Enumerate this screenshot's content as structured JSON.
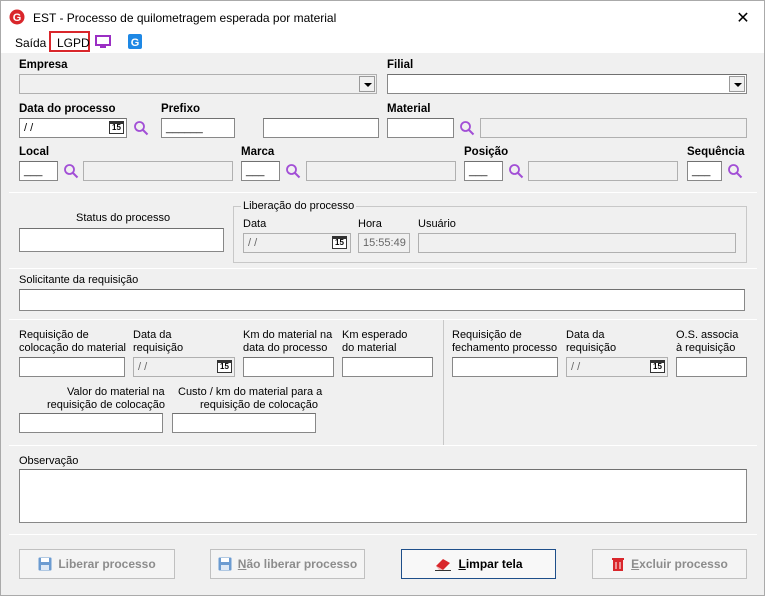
{
  "window": {
    "title": "EST - Processo de quilometragem esperada por material",
    "close_glyph": "✕"
  },
  "menu": {
    "saida": "Saída",
    "lgpd": "LGPD",
    "icons": [
      "monitor-icon",
      "g-app-icon"
    ]
  },
  "colors": {
    "accent_red": "#d9262b",
    "lgpd_border": "#d9262b",
    "monitor_purple": "#9b2fc4",
    "app_blue": "#1e88e5",
    "search_purple": "#a24fd6"
  },
  "header": {
    "empresa_label": "Empresa",
    "empresa_value": "",
    "filial_label": "Filial",
    "filial_value": "",
    "data_processo_label": "Data do processo",
    "data_processo_value": " / /",
    "prefixo_label": "Prefixo",
    "prefixo_value": "______",
    "prefixo_desc": "",
    "material_label": "Material",
    "material_value": "",
    "material_desc": "",
    "local_label": "Local",
    "local_value": "___",
    "local_desc": "",
    "marca_label": "Marca",
    "marca_value": "___",
    "marca_desc": "",
    "posicao_label": "Posição",
    "posicao_value": "___",
    "posicao_desc": "",
    "sequencia_label": "Sequência",
    "sequencia_value": "___",
    "cal_label": "15"
  },
  "status": {
    "label": "Status do processo",
    "value": ""
  },
  "liberacao": {
    "group_label": "Liberação do processo",
    "data_label": "Data",
    "data_value": " / /",
    "hora_label": "Hora",
    "hora_value": "15:55:49",
    "usuario_label": "Usuário",
    "usuario_value": ""
  },
  "solicitante": {
    "label": "Solicitante da requisição",
    "value": ""
  },
  "colocacao": {
    "req_label_1": "Requisição de",
    "req_label_2": "colocação do material",
    "data_label_1": "Data da",
    "data_label_2": "requisição",
    "data_value": " / /",
    "km_mat_label_1": "Km do material na",
    "km_mat_label_2": "data do processo",
    "km_esp_label_1": "Km esperado",
    "km_esp_label_2": "do material",
    "valor_label_1": "Valor do material na",
    "valor_label_2": "requisição de colocação",
    "custo_label_1": "Custo / km do material para a",
    "custo_label_2": "requisição de colocação"
  },
  "fechamento": {
    "req_label_1": "Requisição de",
    "req_label_2": "fechamento processo",
    "data_label_1": "Data da",
    "data_label_2": "requisição",
    "data_value": " / /",
    "os_label_1": "O.S. associa",
    "os_label_2": "à requisição"
  },
  "observacao": {
    "label": "Observação",
    "value": ""
  },
  "buttons": {
    "liberar": "Liberar processo",
    "nao_liberar_first": "N",
    "nao_liberar_rest": "ão liberar processo",
    "limpar_first": "L",
    "limpar_rest": "impar tela",
    "excluir_first": "E",
    "excluir_rest": "xcluir processo"
  }
}
